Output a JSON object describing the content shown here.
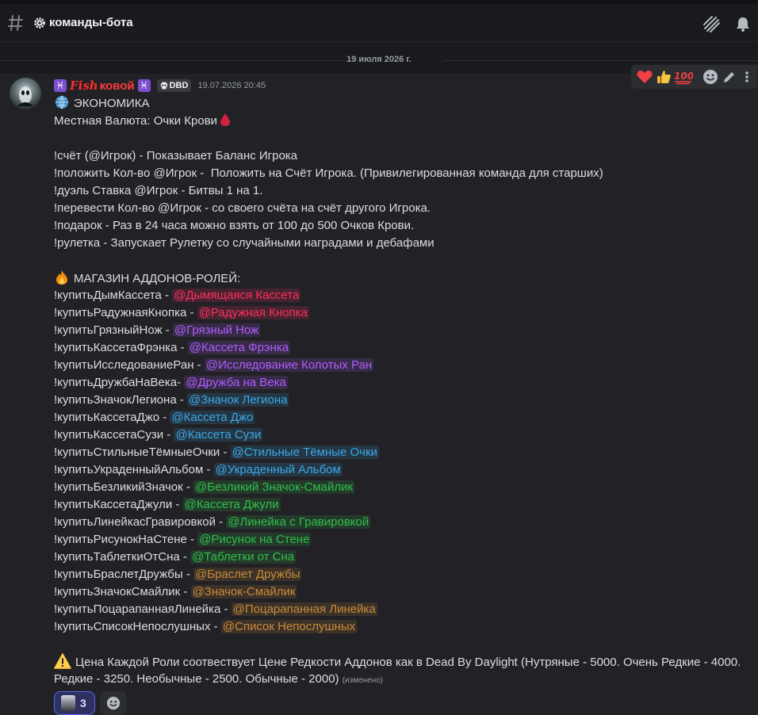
{
  "header": {
    "channel_name": "команды-бота",
    "icons": [
      "hash-icon",
      "gear-icon",
      "threads-icon",
      "bell-icon"
    ]
  },
  "date_divider": "19 июля 2026 г.",
  "message": {
    "author": {
      "name_part1": "Fish",
      "name_part2": "ковой",
      "zodiac": "♓",
      "tag": "DBD",
      "tag_icon": "skull-icon"
    },
    "timestamp": "19.07.2026 20:45",
    "toolbar": [
      "heart",
      "thumbs-up",
      "100",
      "add-reaction",
      "edit",
      "more"
    ],
    "lines": [
      {
        "text": "ЭКОНОМИКА",
        "icon": "globe-icon"
      },
      {
        "text": "Местная Валюта: Очки Крови",
        "icon_after": "blood-drop-icon"
      },
      {
        "blank": true
      },
      {
        "text": "!счёт (@Игрок) - Показывает Баланс Игрока"
      },
      {
        "text": "!положить Кол-во @Игрок -  Положить на Счёт Игрока. (Привилегированная команда для старших)"
      },
      {
        "text": "!дуэль Ставка @Игрок - Битвы 1 на 1."
      },
      {
        "text": "!перевести Кол-во @Игрок - со своего счёта на счёт другого Игрока."
      },
      {
        "text": "!подарок - Раз в 24 часа можно взять от 100 до 500 Очков Крови."
      },
      {
        "text": "!рулетка - Запускает Рулетку со случайными наградами и дебафами"
      },
      {
        "blank": true
      },
      {
        "text": "МАГАЗИН АДДОНОВ-РОЛЕЙ:",
        "icon": "fire-icon"
      },
      {
        "text": "!купитьДымКассета - ",
        "mention": "@Дымящаяся Кассета",
        "color": "#ff2e63"
      },
      {
        "text": "!купитьРадужнаяКнопка - ",
        "mention": "@Радужная Кнопка",
        "color": "#ff2e63"
      },
      {
        "text": "!купитьГрязныйНож - ",
        "mention": "@Грязный Нож",
        "color": "#b05cff"
      },
      {
        "text": "!купитьКассетаФрэнка - ",
        "mention": "@Кассета Фрэнка",
        "color": "#b05cff"
      },
      {
        "text": "!купитьИсследованиеРан - ",
        "mention": "@Исследование Колотых Ран",
        "color": "#b05cff"
      },
      {
        "text": "!купитьДружбаНаВека- ",
        "mention": "@Дружба на Века",
        "color": "#b05cff"
      },
      {
        "text": "!купитьЗначокЛегиона - ",
        "mention": "@Значок Легиона",
        "color": "#3ba7e6"
      },
      {
        "text": "!купитьКассетаДжо - ",
        "mention": "@Кассета Джо",
        "color": "#3ba7e6"
      },
      {
        "text": "!купитьКассетаСузи - ",
        "mention": "@Кассета Сузи",
        "color": "#3ba7e6"
      },
      {
        "text": "!купитьСтильныеТёмныеОчки - ",
        "mention": "@Стильные Тёмные Очки",
        "color": "#3ba7e6"
      },
      {
        "text": "!купитьУкраденныйАльбом - ",
        "mention": "@Украденный Альбом",
        "color": "#3ba7e6"
      },
      {
        "text": "!купитьБезликийЗначок - ",
        "mention": "@Безликий Значок-Смайлик",
        "color": "#2fbf4a"
      },
      {
        "text": "!купитьКассетаДжули - ",
        "mention": "@Кассета Джули",
        "color": "#2fbf4a"
      },
      {
        "text": "!купитьЛинейкасГравировкой - ",
        "mention": "@Линейка с Гравировкой",
        "color": "#2fbf4a"
      },
      {
        "text": "!купитьРисунокНаСтене - ",
        "mention": "@Рисунок на Стене",
        "color": "#2fbf4a"
      },
      {
        "text": "!купитьТаблеткиОтСна - ",
        "mention": "@Таблетки от Сна",
        "color": "#2fbf4a"
      },
      {
        "text": "!купитьБраслетДружбы - ",
        "mention": "@Браслет Дружбы",
        "color": "#c98a3a"
      },
      {
        "text": "!купитьЗначокСмайлик - ",
        "mention": "@Значок-Смайлик",
        "color": "#c98a3a"
      },
      {
        "text": "!купитьПоцарапаннаяЛинейка - ",
        "mention": "@Поцарапанная Линейка",
        "color": "#c98a3a"
      },
      {
        "text": "!купитьСписокНепослушных - ",
        "mention": "@Список Непослушных",
        "color": "#c98a3a"
      },
      {
        "blank": true
      },
      {
        "text": "Цена Каждой Роли соотвествует Цене Редкости Аддонов как в Dead By Daylight (Нутряные - 5000. Очень Редкие - 4000.",
        "icon": "warning-icon"
      },
      {
        "text": "Редкие - 3250. Необычные - 2500. Обычные - 2000) ",
        "edited": "(изменено)"
      }
    ],
    "reactions": [
      {
        "icon": "avatar-reaction",
        "count": "3",
        "active": true
      },
      {
        "icon": "add-reaction-icon"
      }
    ]
  },
  "colors": {
    "background": "#222226",
    "text": "#dbdee1",
    "muted": "#949ba4",
    "accent": "#5865f2"
  }
}
